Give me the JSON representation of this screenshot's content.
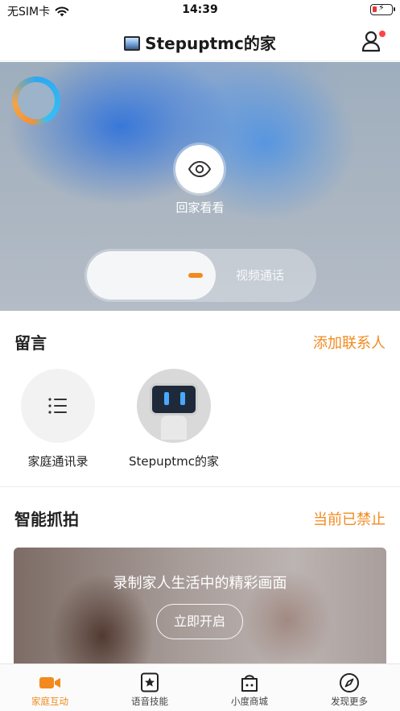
{
  "status_bar": {
    "carrier": "无SIM卡",
    "time": "14:39"
  },
  "nav": {
    "title": "Stepuptmc的家"
  },
  "hero": {
    "look_label": "回家看看",
    "call_label": "视频通话"
  },
  "messages": {
    "title": "留言",
    "action": "添加联系人",
    "contacts": [
      {
        "name": "家庭通讯录"
      },
      {
        "name": "Stepuptmc的家"
      }
    ]
  },
  "snapshot": {
    "title": "智能抓拍",
    "status": "当前已禁止",
    "banner_text": "录制家人生活中的精彩画面",
    "banner_button": "立即开启"
  },
  "tabs": [
    {
      "label": "家庭互动",
      "icon": "video-camera-icon",
      "active": true
    },
    {
      "label": "语音技能",
      "icon": "star-square-icon",
      "active": false
    },
    {
      "label": "小度商城",
      "icon": "shopping-bag-icon",
      "active": false
    },
    {
      "label": "发现更多",
      "icon": "compass-icon",
      "active": false
    }
  ],
  "colors": {
    "accent": "#f28a1f",
    "hero_blue": "#2e6ed6"
  }
}
